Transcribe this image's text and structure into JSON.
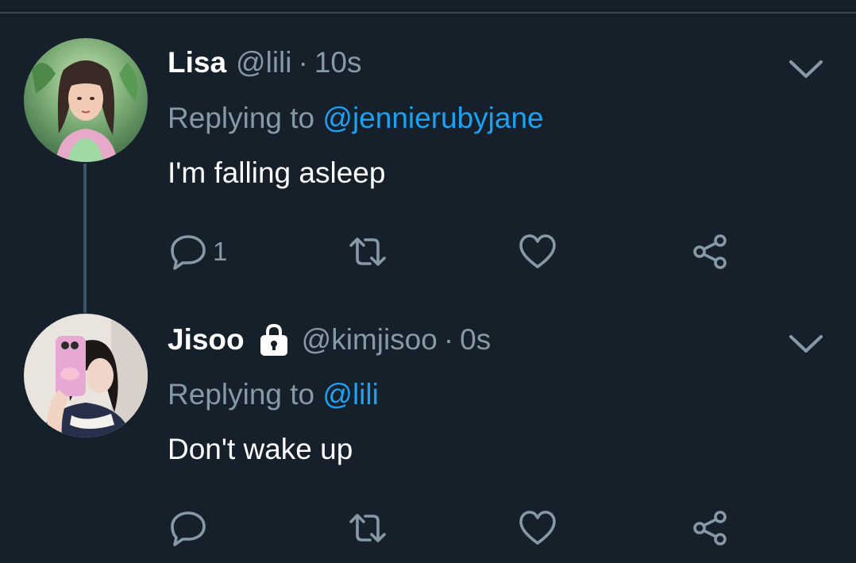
{
  "colors": {
    "background": "#15202b",
    "muted": "#8899a6",
    "link": "#1da1f2",
    "divider": "#38444d",
    "thread_line": "#3d5466"
  },
  "tweets": [
    {
      "display_name": "Lisa",
      "handle": "@lili",
      "separator": "·",
      "time": "10s",
      "protected": false,
      "replying_prefix": "Replying to",
      "replying_to": "@jennierubyjane",
      "text": "I'm falling asleep",
      "reply_count": "1",
      "avatar": "avatar-photo-lisa",
      "menu_icon": "chevron-down-icon"
    },
    {
      "display_name": "Jisoo",
      "handle": "@kimjisoo",
      "separator": "·",
      "time": "0s",
      "protected": true,
      "lock_icon": "lock-icon",
      "replying_prefix": "Replying to",
      "replying_to": "@lili",
      "text": "Don't wake up",
      "reply_count": "",
      "avatar": "avatar-photo-jisoo",
      "menu_icon": "chevron-down-icon"
    }
  ],
  "actions": [
    "reply-icon",
    "retweet-icon",
    "like-icon",
    "share-icon"
  ]
}
